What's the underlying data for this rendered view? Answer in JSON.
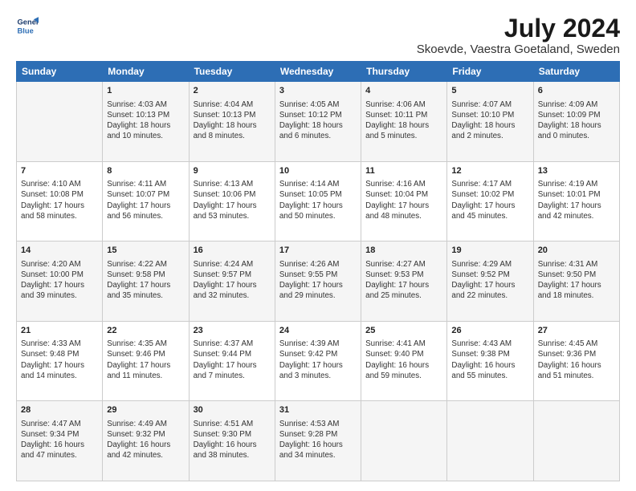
{
  "logo": {
    "line1": "General",
    "line2": "Blue"
  },
  "title": "July 2024",
  "subtitle": "Skoevde, Vaestra Goetaland, Sweden",
  "days_header": [
    "Sunday",
    "Monday",
    "Tuesday",
    "Wednesday",
    "Thursday",
    "Friday",
    "Saturday"
  ],
  "weeks": [
    [
      {
        "day": "",
        "content": ""
      },
      {
        "day": "1",
        "content": "Sunrise: 4:03 AM\nSunset: 10:13 PM\nDaylight: 18 hours\nand 10 minutes."
      },
      {
        "day": "2",
        "content": "Sunrise: 4:04 AM\nSunset: 10:13 PM\nDaylight: 18 hours\nand 8 minutes."
      },
      {
        "day": "3",
        "content": "Sunrise: 4:05 AM\nSunset: 10:12 PM\nDaylight: 18 hours\nand 6 minutes."
      },
      {
        "day": "4",
        "content": "Sunrise: 4:06 AM\nSunset: 10:11 PM\nDaylight: 18 hours\nand 5 minutes."
      },
      {
        "day": "5",
        "content": "Sunrise: 4:07 AM\nSunset: 10:10 PM\nDaylight: 18 hours\nand 2 minutes."
      },
      {
        "day": "6",
        "content": "Sunrise: 4:09 AM\nSunset: 10:09 PM\nDaylight: 18 hours\nand 0 minutes."
      }
    ],
    [
      {
        "day": "7",
        "content": "Sunrise: 4:10 AM\nSunset: 10:08 PM\nDaylight: 17 hours\nand 58 minutes."
      },
      {
        "day": "8",
        "content": "Sunrise: 4:11 AM\nSunset: 10:07 PM\nDaylight: 17 hours\nand 56 minutes."
      },
      {
        "day": "9",
        "content": "Sunrise: 4:13 AM\nSunset: 10:06 PM\nDaylight: 17 hours\nand 53 minutes."
      },
      {
        "day": "10",
        "content": "Sunrise: 4:14 AM\nSunset: 10:05 PM\nDaylight: 17 hours\nand 50 minutes."
      },
      {
        "day": "11",
        "content": "Sunrise: 4:16 AM\nSunset: 10:04 PM\nDaylight: 17 hours\nand 48 minutes."
      },
      {
        "day": "12",
        "content": "Sunrise: 4:17 AM\nSunset: 10:02 PM\nDaylight: 17 hours\nand 45 minutes."
      },
      {
        "day": "13",
        "content": "Sunrise: 4:19 AM\nSunset: 10:01 PM\nDaylight: 17 hours\nand 42 minutes."
      }
    ],
    [
      {
        "day": "14",
        "content": "Sunrise: 4:20 AM\nSunset: 10:00 PM\nDaylight: 17 hours\nand 39 minutes."
      },
      {
        "day": "15",
        "content": "Sunrise: 4:22 AM\nSunset: 9:58 PM\nDaylight: 17 hours\nand 35 minutes."
      },
      {
        "day": "16",
        "content": "Sunrise: 4:24 AM\nSunset: 9:57 PM\nDaylight: 17 hours\nand 32 minutes."
      },
      {
        "day": "17",
        "content": "Sunrise: 4:26 AM\nSunset: 9:55 PM\nDaylight: 17 hours\nand 29 minutes."
      },
      {
        "day": "18",
        "content": "Sunrise: 4:27 AM\nSunset: 9:53 PM\nDaylight: 17 hours\nand 25 minutes."
      },
      {
        "day": "19",
        "content": "Sunrise: 4:29 AM\nSunset: 9:52 PM\nDaylight: 17 hours\nand 22 minutes."
      },
      {
        "day": "20",
        "content": "Sunrise: 4:31 AM\nSunset: 9:50 PM\nDaylight: 17 hours\nand 18 minutes."
      }
    ],
    [
      {
        "day": "21",
        "content": "Sunrise: 4:33 AM\nSunset: 9:48 PM\nDaylight: 17 hours\nand 14 minutes."
      },
      {
        "day": "22",
        "content": "Sunrise: 4:35 AM\nSunset: 9:46 PM\nDaylight: 17 hours\nand 11 minutes."
      },
      {
        "day": "23",
        "content": "Sunrise: 4:37 AM\nSunset: 9:44 PM\nDaylight: 17 hours\nand 7 minutes."
      },
      {
        "day": "24",
        "content": "Sunrise: 4:39 AM\nSunset: 9:42 PM\nDaylight: 17 hours\nand 3 minutes."
      },
      {
        "day": "25",
        "content": "Sunrise: 4:41 AM\nSunset: 9:40 PM\nDaylight: 16 hours\nand 59 minutes."
      },
      {
        "day": "26",
        "content": "Sunrise: 4:43 AM\nSunset: 9:38 PM\nDaylight: 16 hours\nand 55 minutes."
      },
      {
        "day": "27",
        "content": "Sunrise: 4:45 AM\nSunset: 9:36 PM\nDaylight: 16 hours\nand 51 minutes."
      }
    ],
    [
      {
        "day": "28",
        "content": "Sunrise: 4:47 AM\nSunset: 9:34 PM\nDaylight: 16 hours\nand 47 minutes."
      },
      {
        "day": "29",
        "content": "Sunrise: 4:49 AM\nSunset: 9:32 PM\nDaylight: 16 hours\nand 42 minutes."
      },
      {
        "day": "30",
        "content": "Sunrise: 4:51 AM\nSunset: 9:30 PM\nDaylight: 16 hours\nand 38 minutes."
      },
      {
        "day": "31",
        "content": "Sunrise: 4:53 AM\nSunset: 9:28 PM\nDaylight: 16 hours\nand 34 minutes."
      },
      {
        "day": "",
        "content": ""
      },
      {
        "day": "",
        "content": ""
      },
      {
        "day": "",
        "content": ""
      }
    ]
  ]
}
